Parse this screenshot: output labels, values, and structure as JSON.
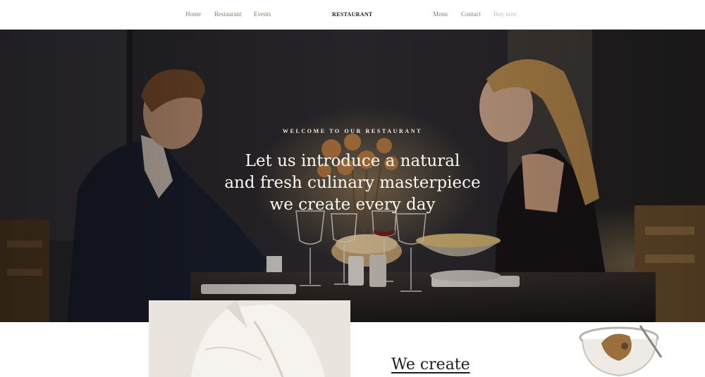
{
  "nav": {
    "left_links": [
      "Home",
      "Restaurant",
      "Events"
    ],
    "logo": "RESTAURANT",
    "right_links": [
      "Menu",
      "Contact",
      "Buy now"
    ]
  },
  "hero": {
    "kicker": "WELCOME TO OUR RESTAURANT",
    "title_lines": [
      "Let us introduce a natural",
      "and fresh culinary masterpiece",
      "we create every day"
    ]
  },
  "section": {
    "title": "We create"
  },
  "colors": {
    "nav_text": "#8a7f74",
    "nav_muted": "#c4bdb5",
    "hero_text": "#fbf7f1"
  }
}
